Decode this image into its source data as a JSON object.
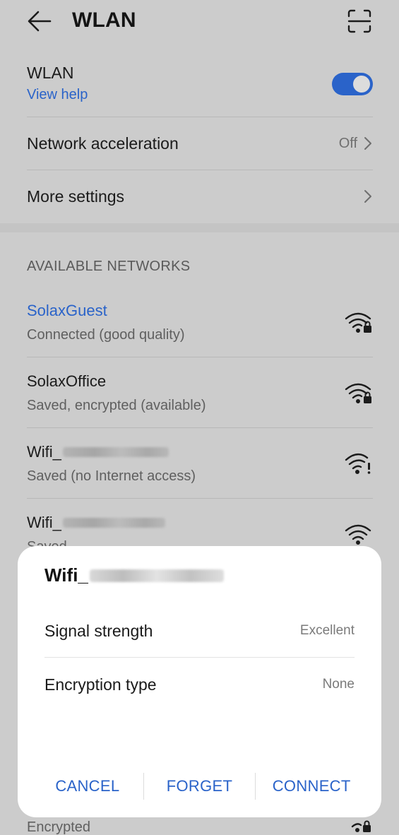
{
  "header": {
    "title": "WLAN"
  },
  "wlan": {
    "label": "WLAN",
    "help": "View help",
    "enabled": true
  },
  "settings": [
    {
      "label": "Network acceleration",
      "value": "Off"
    },
    {
      "label": "More settings",
      "value": ""
    }
  ],
  "section_title": "AVAILABLE NETWORKS",
  "networks": [
    {
      "name": "SolaxGuest",
      "status": "Connected (good quality)",
      "active": true,
      "icon": "wifi-locked-icon"
    },
    {
      "name": "SolaxOffice",
      "status": "Saved, encrypted (available)",
      "active": false,
      "icon": "wifi-locked-icon"
    },
    {
      "name": "Wifi_",
      "status": "Saved (no Internet access)",
      "active": false,
      "icon": "wifi-alert-icon"
    },
    {
      "name": "Wifi_",
      "status": "Saved",
      "active": false,
      "icon": "wifi-icon"
    }
  ],
  "dialog": {
    "title": "Wifi_",
    "rows": [
      {
        "label": "Signal strength",
        "value": "Excellent"
      },
      {
        "label": "Encryption type",
        "value": "None"
      }
    ],
    "buttons": {
      "cancel": "CANCEL",
      "forget": "FORGET",
      "connect": "CONNECT"
    }
  },
  "peek_row": {
    "status": "Encrypted",
    "icon": "wifi-locked-icon"
  },
  "colors": {
    "accent": "#2a63c9",
    "background": "#cccccc",
    "dialog": "#ffffff"
  }
}
